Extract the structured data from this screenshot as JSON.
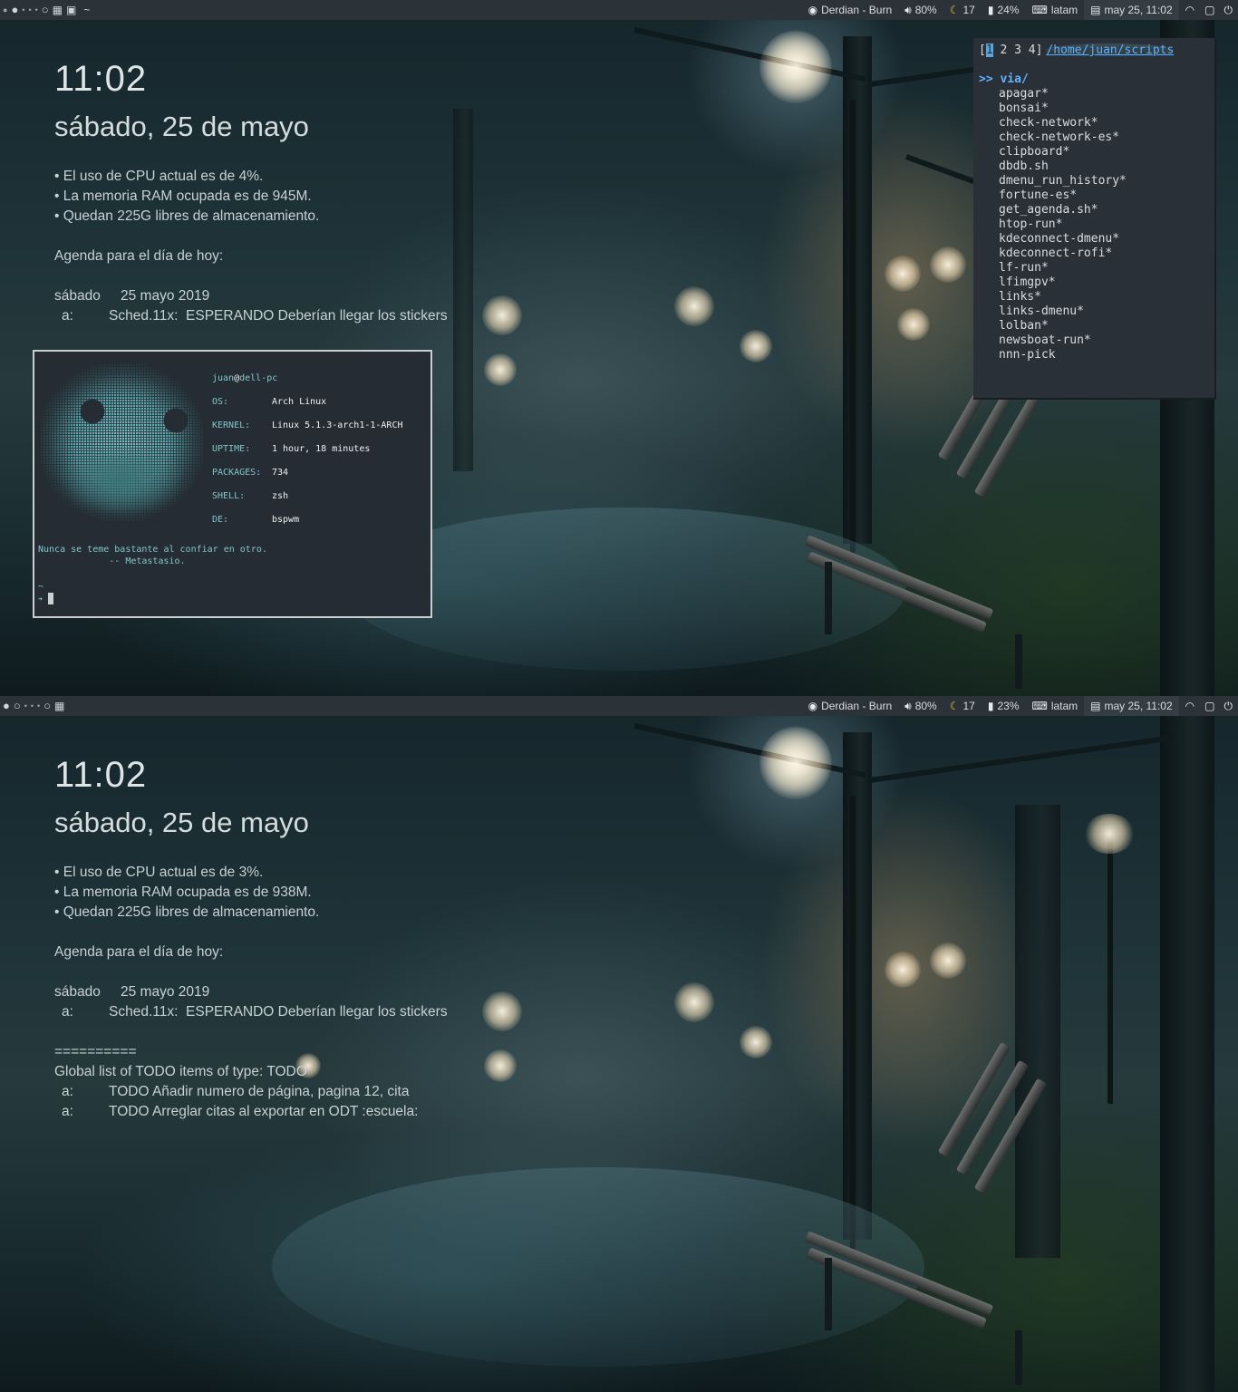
{
  "colors": {
    "bar_bg": "#2b3338",
    "terminal_bg": "#262c33",
    "terminal_accent": "#7fc7cc",
    "lf_bg": "#2a3037",
    "lf_accent": "#5fb3ff"
  },
  "top": {
    "bar": {
      "workspaces": [
        "●",
        "•",
        "•",
        "•",
        "○"
      ],
      "layout_icon": "tiled-icon",
      "title": "~",
      "music": "Derdian - Burn",
      "volume": "80%",
      "temp": "17",
      "battery": "24%",
      "keyboard": "latam",
      "datetime": "may 25, 11:02"
    },
    "conky": {
      "clock": "11:02",
      "date": "sábado, 25 de mayo",
      "cpu": "• El uso de CPU actual es de 4%.",
      "ram": "• La memoria RAM ocupada es de 945M.",
      "disk": "• Quedan 225G libres de almacenamiento.",
      "agenda_title": "Agenda para el día de hoy:",
      "agenda_day": "sábado",
      "agenda_date": "25 mayo 2019",
      "agenda_item_label": "a:",
      "agenda_item": "Sched.11x:  ESPERANDO Deberían llegar los stickers"
    },
    "terminal": {
      "host_user": "juan",
      "host_at": "@",
      "host_name": "dell-pc",
      "rows": [
        {
          "k": "OS:",
          "v": "Arch Linux"
        },
        {
          "k": "KERNEL:",
          "v": "Linux 5.1.3-arch1-1-ARCH"
        },
        {
          "k": "UPTIME:",
          "v": "1 hour, 18 minutes"
        },
        {
          "k": "PACKAGES:",
          "v": "734"
        },
        {
          "k": "SHELL:",
          "v": "zsh"
        },
        {
          "k": "DE:",
          "v": "bspwm"
        }
      ],
      "quote_line1": "Nunca se teme bastante al confiar en otro.",
      "quote_line2": "             -- Metastasio.",
      "prompt_dir": "~",
      "prompt_char": "➜"
    },
    "lf": {
      "tab_open": "[",
      "tab_current": "1",
      "tabs_rest": " 2 3 4]",
      "path": "/home/juan/scripts",
      "selected": ">> via/",
      "files": [
        "apagar*",
        "bonsai*",
        "check-network*",
        "check-network-es*",
        "clipboard*",
        "dbdb.sh",
        "dmenu_run_history*",
        "fortune-es*",
        "get_agenda.sh*",
        "htop-run*",
        "kdeconnect-dmenu*",
        "kdeconnect-rofi*",
        "lf-run*",
        "lfimgpv*",
        "links*",
        "links-dmenu*",
        "lolban*",
        "newsboat-run*",
        "nnn-pick"
      ]
    }
  },
  "bottom": {
    "bar": {
      "workspaces": [
        "●",
        "○",
        "•",
        "•",
        "•",
        "○"
      ],
      "layout_icon": "tiled-icon",
      "music": "Derdian - Burn",
      "volume": "80%",
      "temp": "17",
      "battery": "23%",
      "keyboard": "latam",
      "datetime": "may 25, 11:02"
    },
    "conky": {
      "clock": "11:02",
      "date": "sábado, 25 de mayo",
      "cpu": "• El uso de CPU actual es de 3%.",
      "ram": "• La memoria RAM ocupada es de 938M.",
      "disk": "• Quedan 225G libres de almacenamiento.",
      "agenda_title": "Agenda para el día de hoy:",
      "agenda_day": "sábado",
      "agenda_date": "25 mayo 2019",
      "agenda_item_label": "a:",
      "agenda_item": "Sched.11x:  ESPERANDO Deberían llegar los stickers",
      "separator": "==========",
      "todo_title": "Global list of TODO items of type: TODO",
      "todo_items": [
        {
          "label": "a:",
          "text": "TODO Añadir numero de página, pagina 12, cita"
        },
        {
          "label": "a:",
          "text": "TODO Arreglar citas al exportar en ODT :escuela:"
        }
      ]
    }
  }
}
